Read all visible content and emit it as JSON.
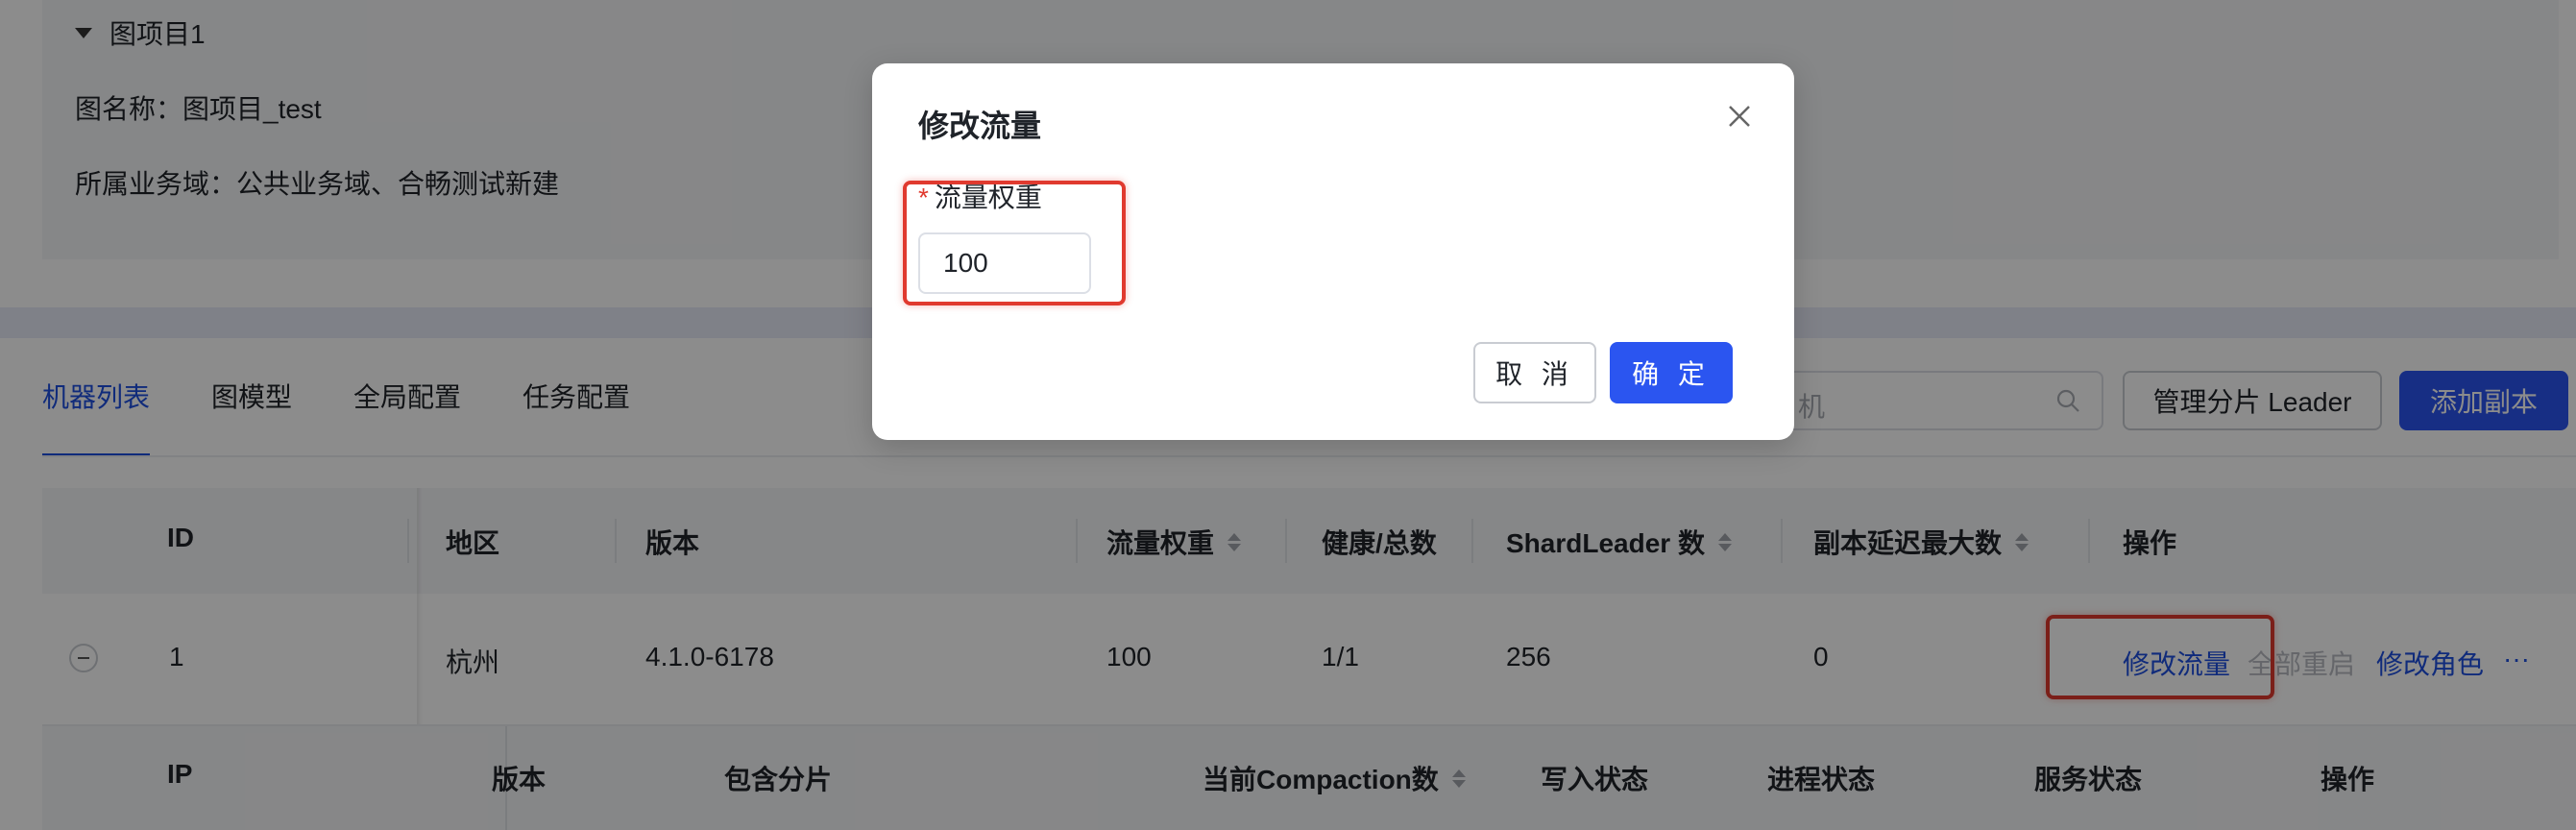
{
  "project": {
    "title": "图项目1",
    "name_line": "图名称：图项目_test",
    "domain_line": "所属业务域：公共业务域、合畅测试新建"
  },
  "tabs": [
    "机器列表",
    "图模型",
    "全局配置",
    "任务配置"
  ],
  "toolbar": {
    "search_placeholder": "机",
    "manage_leader": "管理分片 Leader",
    "add_replica": "添加副本"
  },
  "machine_table": {
    "headers": [
      "ID",
      "地区",
      "版本",
      "流量权重",
      "健康/总数",
      "ShardLeader 数",
      "副本延迟最大数",
      "操作"
    ],
    "row": {
      "id": "1",
      "region": "杭州",
      "version": "4.1.0-6178",
      "weight": "100",
      "health": "1/1",
      "shard_leaders": "256",
      "replica_delay": "0"
    },
    "actions": [
      "修改流量",
      "全部重启",
      "修改角色",
      "···"
    ]
  },
  "sub_table": {
    "headers": [
      "IP",
      "版本",
      "包含分片",
      "当前Compaction数",
      "写入状态",
      "进程状态",
      "服务状态",
      "操作"
    ]
  },
  "modal": {
    "title": "修改流量",
    "required_mark": "*",
    "field_label": "流量权重",
    "field_value": "100",
    "cancel": "取 消",
    "ok": "确 定"
  },
  "colors": {
    "primary": "#2b55f0",
    "link": "#1e4fe0",
    "highlight": "#e03a2f"
  }
}
